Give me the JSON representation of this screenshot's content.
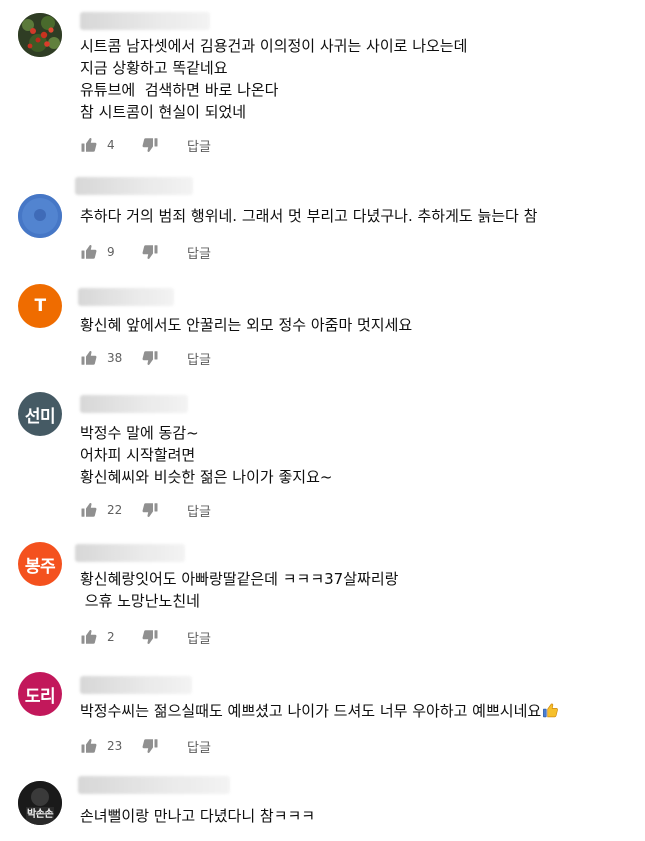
{
  "colors": {
    "action_icon": "#909090",
    "secondary_text": "#606060"
  },
  "icons": {
    "like": "thumbs-up-icon",
    "dislike": "thumbs-down-icon",
    "emoji": "thumbs-up-emoji-icon"
  },
  "reply_label": "답글",
  "comments": [
    {
      "avatar": {
        "type": "photo",
        "text": "",
        "bg": "#3a4a2a"
      },
      "lines": [
        "시트콤 남자셋에서 김용건과 이의정이 사귀는 사이로 나오는데",
        "지금 상황하고 똑같네요",
        "유튜브에  검색하면 바로 나온다",
        "참 시트콤이 현실이 되었네"
      ],
      "likes": "4"
    },
    {
      "avatar": {
        "type": "photo",
        "text": "",
        "bg": "#4a79c2"
      },
      "lines": [
        "추하다 거의 범죄 행위네. 그래서 멋 부리고 다녔구나. 추하게도 늙는다 참"
      ],
      "likes": "9"
    },
    {
      "avatar": {
        "type": "letter",
        "text": "T",
        "bg": "#ef6c00"
      },
      "lines": [
        "황신혜 앞에서도 안꿀리는 외모 정수 아줌마 멋지세요"
      ],
      "likes": "38"
    },
    {
      "avatar": {
        "type": "letter",
        "text": "선미",
        "bg": "#455a64"
      },
      "lines": [
        "박정수 말에 동감~",
        "어차피 시작할려면",
        "황신혜씨와 비슷한 젊은 나이가 좋지요~"
      ],
      "likes": "22"
    },
    {
      "avatar": {
        "type": "letter",
        "text": "봉주",
        "bg": "#f4511e"
      },
      "lines": [
        "황신혜랑잇어도 아빠랑딸같은데 ㅋㅋㅋ37살짜리랑",
        " 으휴 노망난노친네"
      ],
      "likes": "2"
    },
    {
      "avatar": {
        "type": "letter",
        "text": "도리",
        "bg": "#c2185b"
      },
      "lines": [
        "박정수씨는 젊으실때도 예쁘셨고 나이가 드셔도 너무 우아하고 예쁘시네요"
      ],
      "emoji_line": 0,
      "likes": "23"
    },
    {
      "avatar": {
        "type": "photo",
        "text": "박손손",
        "bg": "#1f1f1f"
      },
      "lines": [
        "손녀뻘이랑 만나고 다녔다니 참ㅋㅋㅋ"
      ],
      "likes": ""
    }
  ]
}
